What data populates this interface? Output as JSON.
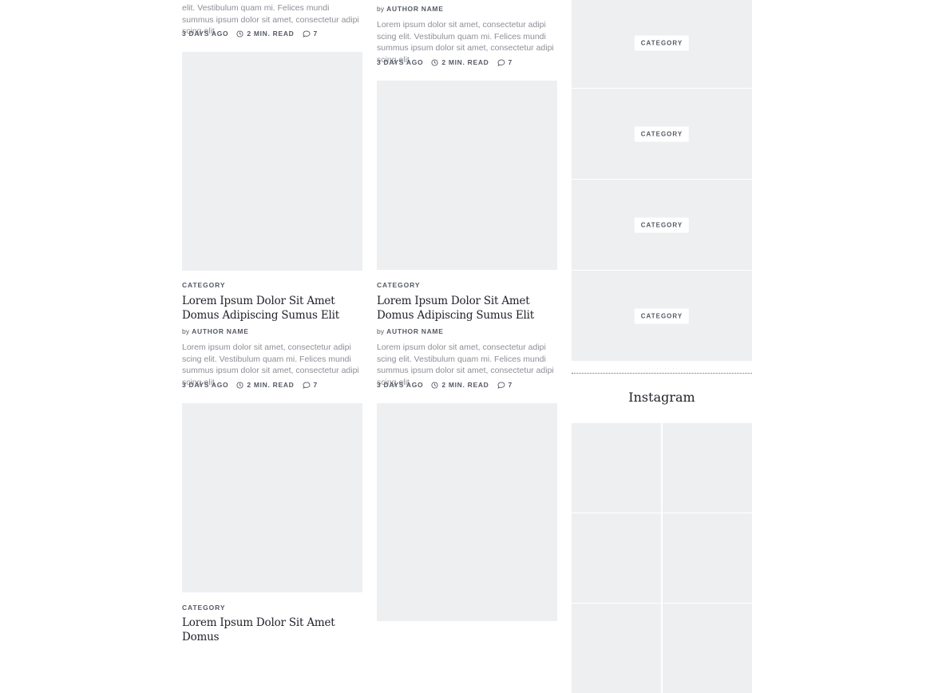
{
  "posts": {
    "excerpt": "Lorem ipsum dolor sit amet, consectetur adipi scing elit. Vestibulum quam mi. Felices mundi summus ipsum dolor sit amet, consectetur adipi scing elit",
    "excerpt_top_left": "elit. Vestibulum quam mi. Felices mundi summus ipsum dolor sit amet, consectetur adipi scing elit",
    "category": "CATEGORY",
    "title": "Lorem Ipsum Dolor Sit Amet Domus Adipiscing Sumus Elit",
    "title_partial": "Lorem Ipsum Dolor Sit Amet Domus",
    "author_prefix": "by",
    "author": "AUTHOR NAME",
    "date": "3 DAYS AGO",
    "read_time": "2 MIN. READ",
    "comments": "7"
  },
  "sidebar": {
    "categories": [
      "CATEGORY",
      "CATEGORY",
      "CATEGORY",
      "CATEGORY"
    ],
    "instagram_title": "Instagram"
  },
  "icons": {
    "clock": "clock-icon",
    "comment": "comment-icon"
  },
  "colors": {
    "placeholder": "#eeeff1",
    "text_muted": "#8e8f98",
    "text_meta": "#555a66",
    "heading": "#1f2028"
  }
}
